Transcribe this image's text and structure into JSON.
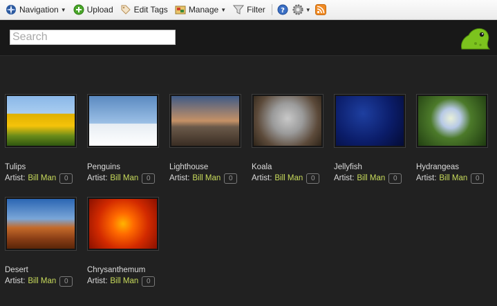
{
  "toolbar": {
    "navigation": "Navigation",
    "upload": "Upload",
    "edit_tags": "Edit Tags",
    "manage": "Manage",
    "filter": "Filter"
  },
  "search": {
    "placeholder": "Search"
  },
  "artist_label": "Artist:",
  "photos": [
    {
      "title": "Tulips",
      "artist": "Bill Man",
      "count": "0"
    },
    {
      "title": "Penguins",
      "artist": "Bill Man",
      "count": "0"
    },
    {
      "title": "Lighthouse",
      "artist": "Bill Man",
      "count": "0"
    },
    {
      "title": "Koala",
      "artist": "Bill Man",
      "count": "0"
    },
    {
      "title": "Jellyfish",
      "artist": "Bill Man",
      "count": "0"
    },
    {
      "title": "Hydrangeas",
      "artist": "Bill Man",
      "count": "0"
    },
    {
      "title": "Desert",
      "artist": "Bill Man",
      "count": "0"
    },
    {
      "title": "Chrysanthemum",
      "artist": "Bill Man",
      "count": "0"
    }
  ],
  "colors": {
    "background": "#212121",
    "artist_accent": "#c9dc5c",
    "logo_green": "#7cc31e"
  }
}
